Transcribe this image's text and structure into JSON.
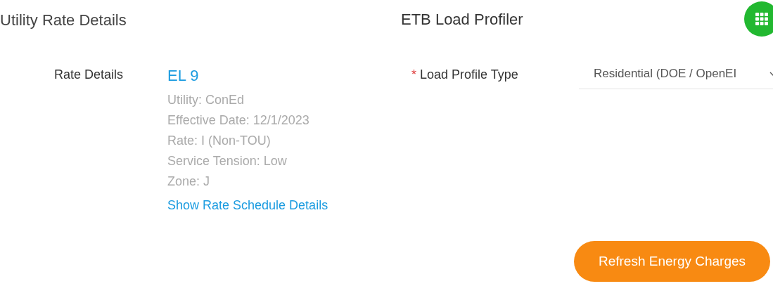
{
  "rate_section": {
    "title": "Utility Rate Details",
    "label": "Rate Details",
    "rate_name": "EL 9",
    "details": [
      "Utility: ConEd",
      "Effective Date: 12/1/2023",
      "Rate: I (Non-TOU)",
      "Service Tension: Low",
      "Zone: J"
    ],
    "link": "Show Rate Schedule Details"
  },
  "profiler": {
    "title": "ETB Load Profiler",
    "field": {
      "required_mark": "*",
      "label": "Load Profile Type",
      "value": "Residential (DOE / OpenEI"
    },
    "button": "Refresh Energy Charges"
  }
}
